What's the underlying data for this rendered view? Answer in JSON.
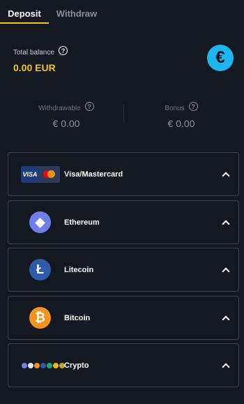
{
  "tabs": {
    "deposit": "Deposit",
    "withdraw": "Withdraw"
  },
  "balance": {
    "label": "Total balance",
    "value": "0.00 EUR",
    "currency_symbol": "€"
  },
  "stats": {
    "withdrawable": {
      "label": "Withdrawable",
      "value": "€ 0.00"
    },
    "bonus": {
      "label": "Bonus",
      "value": "€ 0.00"
    }
  },
  "help_glyph": "?",
  "methods": [
    {
      "name": "Visa/Mastercard",
      "icon": "visa-mastercard-icon"
    },
    {
      "name": "Ethereum",
      "icon": "ethereum-icon",
      "glyph": "◆"
    },
    {
      "name": "Litecoin",
      "icon": "litecoin-icon",
      "glyph": "Ł"
    },
    {
      "name": "Bitcoin",
      "icon": "bitcoin-icon",
      "glyph": "₿"
    },
    {
      "name": "Crypto",
      "icon": "crypto-coins-icon"
    }
  ],
  "visa_text": "VISA",
  "colors": {
    "accent": "#f5c518",
    "currency_badge": "#1fb6f0",
    "background": "#141820"
  }
}
